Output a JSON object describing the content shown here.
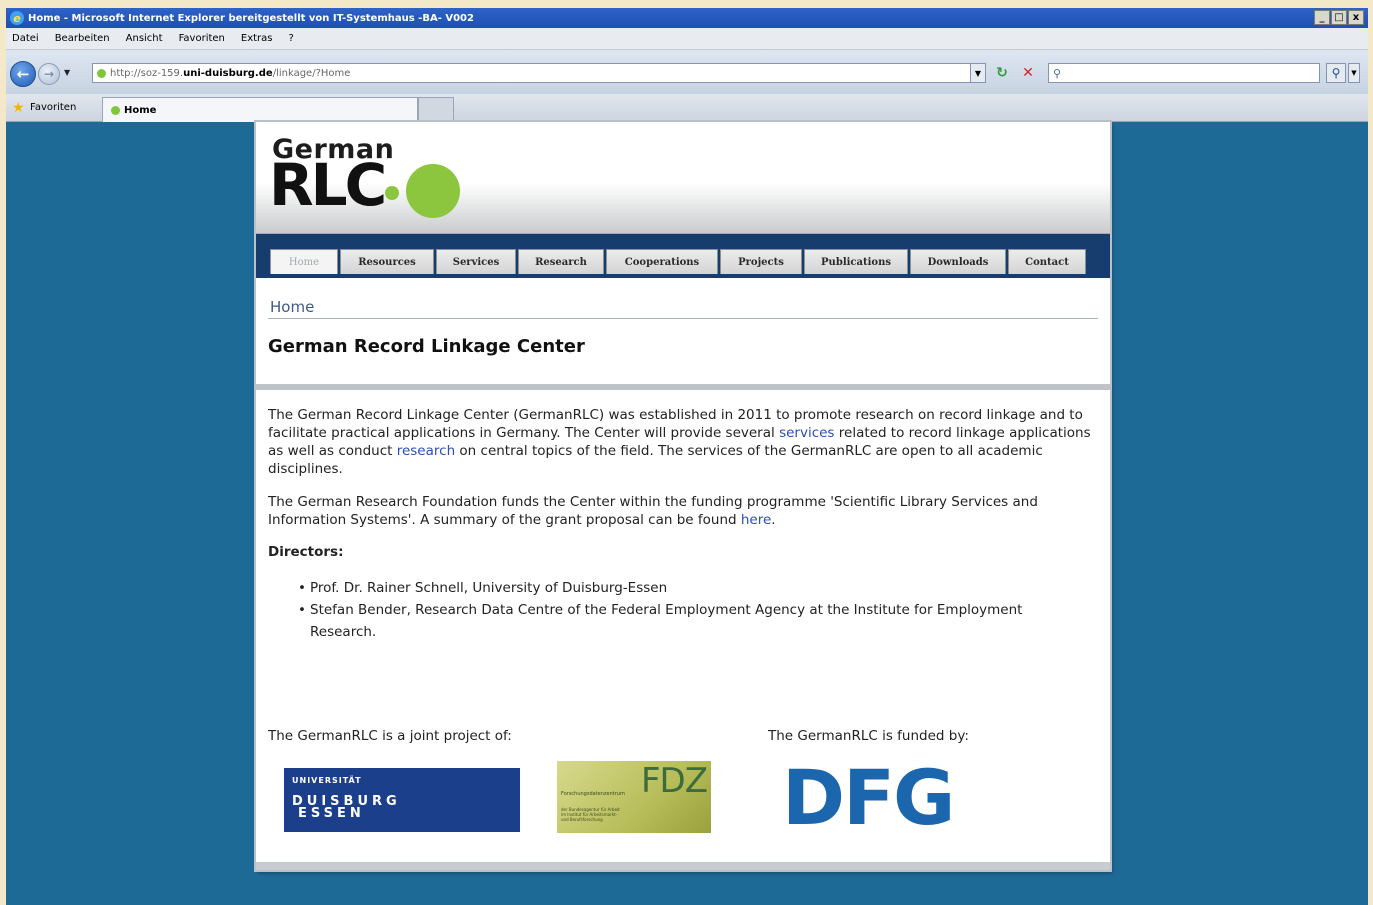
{
  "browser": {
    "title": "Home - Microsoft Internet Explorer bereitgestellt von IT-Systemhaus -BA- V002",
    "window_controls": {
      "minimize": "_",
      "maximize": "□",
      "close": "x"
    },
    "menu": [
      "Datei",
      "Bearbeiten",
      "Ansicht",
      "Favoriten",
      "Extras",
      "?"
    ],
    "url_prefix": "http://soz-159.",
    "url_domain": "uni-duisburg.de",
    "url_path": "/linkage/?Home",
    "favorites_label": "Favoriten",
    "tab_label": "Home"
  },
  "site": {
    "logo_top": "German",
    "logo_bottom": "RLC",
    "nav": [
      "Home",
      "Resources",
      "Services",
      "Research",
      "Cooperations",
      "Projects",
      "Publications",
      "Downloads",
      "Contact"
    ],
    "breadcrumb": "Home",
    "title": "German Record Linkage Center",
    "p1_a": "The German Record Linkage Center (GermanRLC) was established in 2011 to promote research on record linkage and to facilitate practical applications in Germany. The Center will provide several ",
    "p1_link1": "services",
    "p1_b": " related to record linkage applications as well as conduct ",
    "p1_link2": "research",
    "p1_c": " on central topics of the field. The services of the GermanRLC are open to all academic disciplines.",
    "p2_a": "The German Research Foundation funds the Center within the funding programme 'Scientific Library Services and Information Systems'. A summary of the grant proposal can be found ",
    "p2_link": "here",
    "p2_b": ".",
    "directors_heading": "Directors:",
    "directors": [
      "Prof. Dr. Rainer Schnell, University of Duisburg-Essen",
      "Stefan Bender, Research Data Centre of the Federal Employment Agency at the Institute for Employment Research."
    ],
    "joint_text": "The GermanRLC is a joint project of:",
    "funded_text": "The GermanRLC is funded by:",
    "ude_logo": {
      "top": "UNIVERSITÄT",
      "line1": "DUISBURG",
      "line2": "ESSEN"
    },
    "fdz_logo": {
      "big": "FDZ",
      "small": "Forschungsdatenzentrum",
      "tiny": "der Bundesagentur für Arbeit im Institut für Arbeitsmarkt- und Berufsforschung"
    },
    "dfg_logo": "DFG"
  },
  "colors": {
    "page_background": "#1e6a96",
    "nav_background": "#173d6e",
    "logo_green": "#8cc63f",
    "link": "#2b4fb3",
    "dfg_blue": "#1b66ad",
    "ude_blue": "#1c3f8c"
  }
}
